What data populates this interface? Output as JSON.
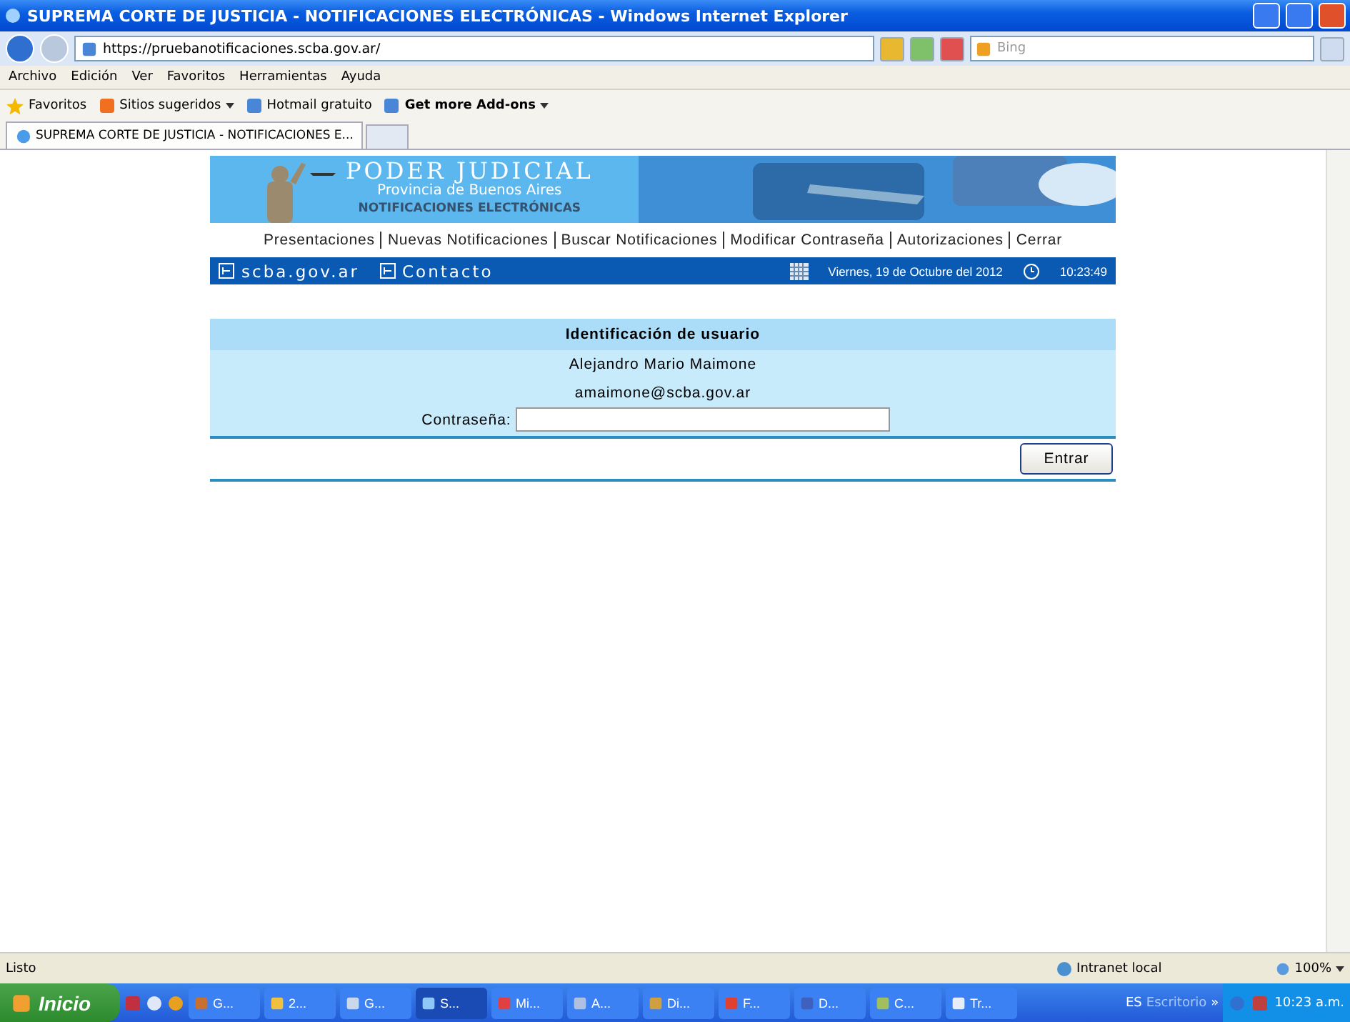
{
  "window": {
    "title": "SUPREMA CORTE DE JUSTICIA - NOTIFICACIONES ELECTRÓNICAS - Windows Internet Explorer"
  },
  "address_bar": {
    "url": "https://pruebanotificaciones.scba.gov.ar/",
    "search_placeholder": "Bing"
  },
  "menu": [
    "Archivo",
    "Edición",
    "Ver",
    "Favoritos",
    "Herramientas",
    "Ayuda"
  ],
  "favorites_bar": [
    {
      "label": "Favoritos",
      "kind": "star"
    },
    {
      "label": "Sitios sugeridos",
      "kind": "dropdown"
    },
    {
      "label": "Hotmail gratuito",
      "kind": "link"
    },
    {
      "label": "Get more Add-ons",
      "kind": "bold-dropdown"
    }
  ],
  "tabs": [
    {
      "label": "SUPREMA CORTE DE JUSTICIA - NOTIFICACIONES E...",
      "selected": true
    }
  ],
  "banner": {
    "title": "PODER JUDICIAL",
    "subtitle": "Provincia de Buenos Aires",
    "caption": "NOTIFICACIONES ELECTRÓNICAS"
  },
  "nav": [
    "Presentaciones",
    "Nuevas Notificaciones",
    "Buscar Notificaciones",
    "Modificar Contraseña",
    "Autorizaciones",
    "Cerrar"
  ],
  "info_bar": {
    "links": [
      "scba.gov.ar",
      "Contacto"
    ],
    "date": "Viernes, 19 de Octubre del 2012",
    "time": "10:23:49"
  },
  "login": {
    "heading": "Identificación de usuario",
    "name": "Alejandro Mario Maimone",
    "email": "amaimone@scba.gov.ar",
    "password_label": "Contraseña:",
    "button": "Entrar"
  },
  "status_bar": {
    "text": "Listo",
    "zone": "Intranet local",
    "zoom": "100%"
  },
  "taskbar": {
    "start": "Inicio",
    "items": [
      {
        "label": "G...",
        "selected": false
      },
      {
        "label": "2...",
        "selected": false
      },
      {
        "label": "G...",
        "selected": false
      },
      {
        "label": "S...",
        "selected": true
      },
      {
        "label": "Mi...",
        "selected": false
      },
      {
        "label": "A...",
        "selected": false
      },
      {
        "label": "Di...",
        "selected": false
      },
      {
        "label": "F...",
        "selected": false
      },
      {
        "label": "D...",
        "selected": false
      },
      {
        "label": "C...",
        "selected": false
      },
      {
        "label": "Tr...",
        "selected": false
      }
    ],
    "language": "ES",
    "toolbar": "Escritorio",
    "more": "»",
    "clock": "10:23 a.m."
  }
}
